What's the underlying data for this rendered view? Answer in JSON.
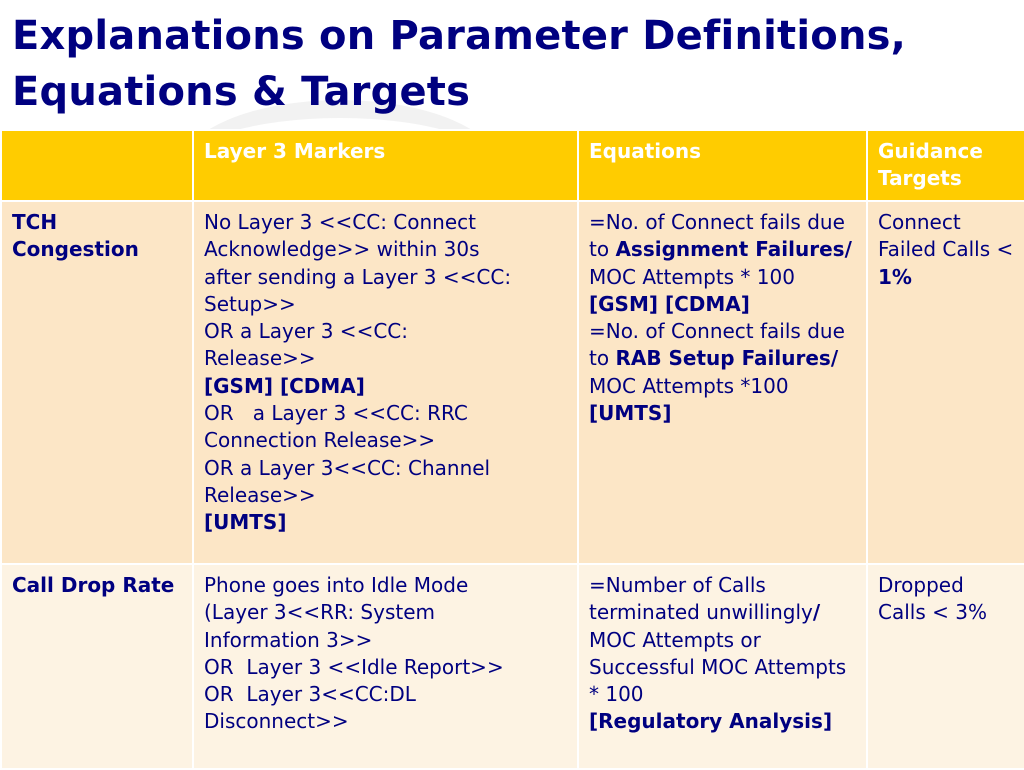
{
  "title": {
    "line1": "Explanations on Parameter Definitions,",
    "line2": "Equations & Targets"
  },
  "table": {
    "headers": [
      "",
      "Layer 3 Markers",
      "Equations",
      "Guidance Targets"
    ],
    "rows": [
      {
        "parameter": "TCH Congestion",
        "markers": [
          "No Layer 3 <<CC: Connect",
          "Acknowledge>> within 30s",
          "after sending a Layer 3 <<CC:",
          "Setup>>",
          "OR a Layer 3 <<CC:",
          "Release>>",
          "[GSM] [CDMA]",
          "OR   a Layer 3 <<CC: RRC",
          "Connection Release>>",
          "OR a Layer 3<<CC: Channel",
          "Release>>",
          "[UMTS]"
        ],
        "equations": {
          "gsm_prefix": "=No. of Connect fails due to ",
          "gsm_bold": "Assignment Failures/",
          "gsm_suffix": " MOC Attempts * 100",
          "gsm_tag": "[GSM] [CDMA]",
          "umts_prefix": "=No. of Connect fails due to ",
          "umts_bold": "RAB Setup Failures/",
          "umts_suffix": " MOC Attempts  *100",
          "umts_tag": "[UMTS]"
        },
        "target": {
          "text": "Connect Failed Calls < ",
          "bold": "1%"
        }
      },
      {
        "parameter": "Call Drop Rate",
        "markers": [
          "Phone goes into Idle Mode",
          "(Layer 3<<RR: System",
          "Information 3>>",
          "OR  Layer 3 <<Idle Report>>",
          "OR  Layer 3<<CC:DL",
          "Disconnect>>"
        ],
        "equations": {
          "prefix": "=Number of Calls terminated unwillingly",
          "slash": "/",
          "suffix": " MOC Attempts or Successful MOC Attempts * 100",
          "tag": "[Regulatory Analysis]"
        },
        "target": {
          "text": " Dropped Calls < 3%"
        }
      }
    ]
  },
  "colors": {
    "title": "#000080",
    "header_bg": "#ffcc00",
    "header_text": "#ffffff",
    "row1_bg": "#fce6c6",
    "row2_bg": "#fdf3e3",
    "body_text": "#000080"
  }
}
